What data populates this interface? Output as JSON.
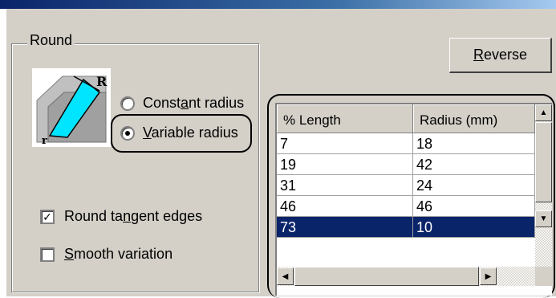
{
  "group": {
    "title": "Round"
  },
  "options": {
    "constant_radius": {
      "label_pre": "Const",
      "label_key": "a",
      "label_post": "nt radius"
    },
    "variable_radius": {
      "label_pre": "",
      "label_key": "V",
      "label_post": "ariable radius"
    },
    "selected": "variable_radius"
  },
  "checks": {
    "round_tangent": {
      "label_pre": "Round ta",
      "label_key": "n",
      "label_post": "gent edges",
      "checked": true
    },
    "smooth_variation": {
      "label_pre": "",
      "label_key": "S",
      "label_post": "mooth variation",
      "checked": false
    }
  },
  "reverse_button": {
    "label_key": "R",
    "label_post": "everse"
  },
  "icon": {
    "label_big": "R",
    "label_small": "r",
    "name": "round-variable-radius-icon"
  },
  "table": {
    "columns": [
      "% Length",
      "Radius (mm)"
    ],
    "rows": [
      [
        "7",
        "18"
      ],
      [
        "19",
        "42"
      ],
      [
        "31",
        "24"
      ],
      [
        "46",
        "46"
      ],
      [
        "73",
        "10"
      ]
    ],
    "selected_row": 4
  },
  "colors": {
    "dialog_bg": "#d4d0c8",
    "selection": "#0a246a",
    "icon_fill": "#00e5ff"
  }
}
